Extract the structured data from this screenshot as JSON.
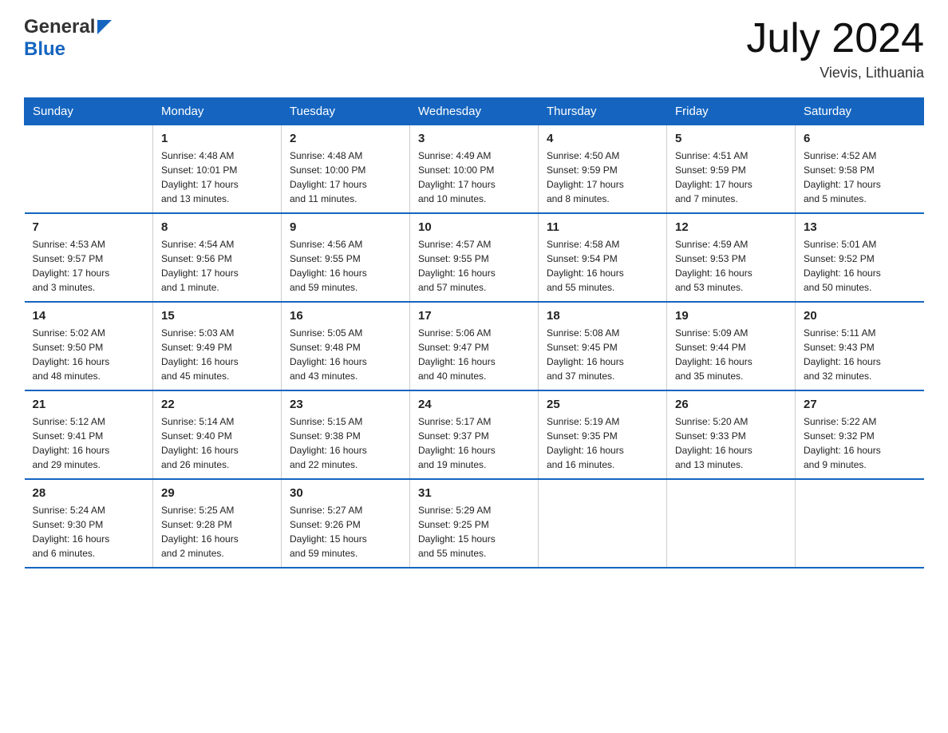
{
  "header": {
    "logo_general": "General",
    "logo_blue": "Blue",
    "title": "July 2024",
    "subtitle": "Vievis, Lithuania"
  },
  "calendar": {
    "days_of_week": [
      "Sunday",
      "Monday",
      "Tuesday",
      "Wednesday",
      "Thursday",
      "Friday",
      "Saturday"
    ],
    "weeks": [
      [
        {
          "day": "",
          "info": ""
        },
        {
          "day": "1",
          "info": "Sunrise: 4:48 AM\nSunset: 10:01 PM\nDaylight: 17 hours\nand 13 minutes."
        },
        {
          "day": "2",
          "info": "Sunrise: 4:48 AM\nSunset: 10:00 PM\nDaylight: 17 hours\nand 11 minutes."
        },
        {
          "day": "3",
          "info": "Sunrise: 4:49 AM\nSunset: 10:00 PM\nDaylight: 17 hours\nand 10 minutes."
        },
        {
          "day": "4",
          "info": "Sunrise: 4:50 AM\nSunset: 9:59 PM\nDaylight: 17 hours\nand 8 minutes."
        },
        {
          "day": "5",
          "info": "Sunrise: 4:51 AM\nSunset: 9:59 PM\nDaylight: 17 hours\nand 7 minutes."
        },
        {
          "day": "6",
          "info": "Sunrise: 4:52 AM\nSunset: 9:58 PM\nDaylight: 17 hours\nand 5 minutes."
        }
      ],
      [
        {
          "day": "7",
          "info": "Sunrise: 4:53 AM\nSunset: 9:57 PM\nDaylight: 17 hours\nand 3 minutes."
        },
        {
          "day": "8",
          "info": "Sunrise: 4:54 AM\nSunset: 9:56 PM\nDaylight: 17 hours\nand 1 minute."
        },
        {
          "day": "9",
          "info": "Sunrise: 4:56 AM\nSunset: 9:55 PM\nDaylight: 16 hours\nand 59 minutes."
        },
        {
          "day": "10",
          "info": "Sunrise: 4:57 AM\nSunset: 9:55 PM\nDaylight: 16 hours\nand 57 minutes."
        },
        {
          "day": "11",
          "info": "Sunrise: 4:58 AM\nSunset: 9:54 PM\nDaylight: 16 hours\nand 55 minutes."
        },
        {
          "day": "12",
          "info": "Sunrise: 4:59 AM\nSunset: 9:53 PM\nDaylight: 16 hours\nand 53 minutes."
        },
        {
          "day": "13",
          "info": "Sunrise: 5:01 AM\nSunset: 9:52 PM\nDaylight: 16 hours\nand 50 minutes."
        }
      ],
      [
        {
          "day": "14",
          "info": "Sunrise: 5:02 AM\nSunset: 9:50 PM\nDaylight: 16 hours\nand 48 minutes."
        },
        {
          "day": "15",
          "info": "Sunrise: 5:03 AM\nSunset: 9:49 PM\nDaylight: 16 hours\nand 45 minutes."
        },
        {
          "day": "16",
          "info": "Sunrise: 5:05 AM\nSunset: 9:48 PM\nDaylight: 16 hours\nand 43 minutes."
        },
        {
          "day": "17",
          "info": "Sunrise: 5:06 AM\nSunset: 9:47 PM\nDaylight: 16 hours\nand 40 minutes."
        },
        {
          "day": "18",
          "info": "Sunrise: 5:08 AM\nSunset: 9:45 PM\nDaylight: 16 hours\nand 37 minutes."
        },
        {
          "day": "19",
          "info": "Sunrise: 5:09 AM\nSunset: 9:44 PM\nDaylight: 16 hours\nand 35 minutes."
        },
        {
          "day": "20",
          "info": "Sunrise: 5:11 AM\nSunset: 9:43 PM\nDaylight: 16 hours\nand 32 minutes."
        }
      ],
      [
        {
          "day": "21",
          "info": "Sunrise: 5:12 AM\nSunset: 9:41 PM\nDaylight: 16 hours\nand 29 minutes."
        },
        {
          "day": "22",
          "info": "Sunrise: 5:14 AM\nSunset: 9:40 PM\nDaylight: 16 hours\nand 26 minutes."
        },
        {
          "day": "23",
          "info": "Sunrise: 5:15 AM\nSunset: 9:38 PM\nDaylight: 16 hours\nand 22 minutes."
        },
        {
          "day": "24",
          "info": "Sunrise: 5:17 AM\nSunset: 9:37 PM\nDaylight: 16 hours\nand 19 minutes."
        },
        {
          "day": "25",
          "info": "Sunrise: 5:19 AM\nSunset: 9:35 PM\nDaylight: 16 hours\nand 16 minutes."
        },
        {
          "day": "26",
          "info": "Sunrise: 5:20 AM\nSunset: 9:33 PM\nDaylight: 16 hours\nand 13 minutes."
        },
        {
          "day": "27",
          "info": "Sunrise: 5:22 AM\nSunset: 9:32 PM\nDaylight: 16 hours\nand 9 minutes."
        }
      ],
      [
        {
          "day": "28",
          "info": "Sunrise: 5:24 AM\nSunset: 9:30 PM\nDaylight: 16 hours\nand 6 minutes."
        },
        {
          "day": "29",
          "info": "Sunrise: 5:25 AM\nSunset: 9:28 PM\nDaylight: 16 hours\nand 2 minutes."
        },
        {
          "day": "30",
          "info": "Sunrise: 5:27 AM\nSunset: 9:26 PM\nDaylight: 15 hours\nand 59 minutes."
        },
        {
          "day": "31",
          "info": "Sunrise: 5:29 AM\nSunset: 9:25 PM\nDaylight: 15 hours\nand 55 minutes."
        },
        {
          "day": "",
          "info": ""
        },
        {
          "day": "",
          "info": ""
        },
        {
          "day": "",
          "info": ""
        }
      ]
    ]
  }
}
